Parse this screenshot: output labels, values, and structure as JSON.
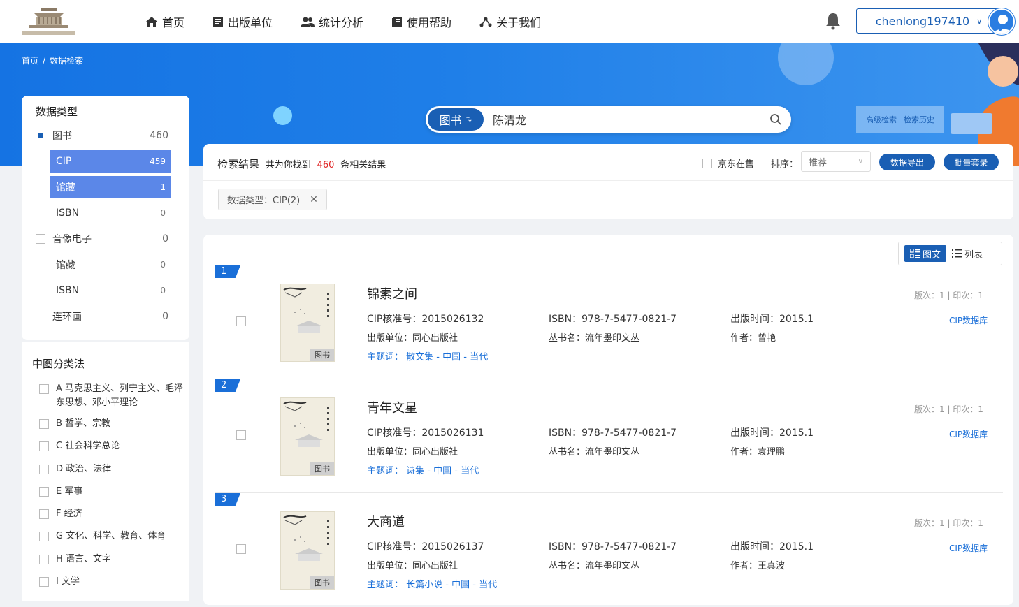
{
  "nav": {
    "home": "首页",
    "publishers": "出版单位",
    "statistics": "统计分析",
    "help": "使用帮助",
    "about": "关于我们"
  },
  "user": {
    "name": "chenlong197410"
  },
  "breadcrumb": {
    "home": "首页",
    "sep": "/",
    "current": "数据检索"
  },
  "search": {
    "type": "图书",
    "type_arrow": "⇅",
    "query": "陈清龙",
    "advanced": "高级检索",
    "history": "检索历史"
  },
  "sidebar": {
    "data_type_title": "数据类型",
    "types": [
      {
        "label": "图书",
        "count": "460",
        "checked": true,
        "subs": [
          {
            "label": "CIP",
            "count": "459",
            "active": true
          },
          {
            "label": "馆藏",
            "count": "1",
            "active": true
          },
          {
            "label": "ISBN",
            "count": "0",
            "active": false
          }
        ]
      },
      {
        "label": "音像电子",
        "count": "0",
        "checked": false,
        "subs": [
          {
            "label": "馆藏",
            "count": "0",
            "active": false
          },
          {
            "label": "ISBN",
            "count": "0",
            "active": false
          }
        ]
      },
      {
        "label": "连环画",
        "count": "0",
        "checked": false,
        "subs": []
      }
    ],
    "class_title": "中图分类法",
    "classes": [
      "A 马克思主义、列宁主义、毛泽东思想、邓小平理论",
      "B 哲学、宗教",
      "C 社会科学总论",
      "D 政治、法律",
      "E 军事",
      "F 经济",
      "G 文化、科学、教育、体育",
      "H 语言、文字",
      "I 文学"
    ]
  },
  "results": {
    "title": "检索结果",
    "found_prefix": "共为你找到",
    "count": "460",
    "found_suffix": "条相关结果",
    "jd_label": "京东在售",
    "sort_label": "排序：",
    "sort_value": "推荐",
    "export_label": "数据导出",
    "batch_label": "批量套录",
    "filter_tag": "数据类型：CIP(2)",
    "view_grid": "图文",
    "view_list": "列表"
  },
  "items": [
    {
      "index": "1",
      "title": "锦素之间",
      "cip": "CIP核准号：2015026132",
      "isbn": "ISBN：978-7-5477-0821-7",
      "pubdate": "出版时间：2015.1",
      "publisher": "出版单位：同心出版社",
      "series": "丛书名：流年墨印文丛",
      "author": "作者：曾艳",
      "subject_label": "主题词：",
      "subject": "散文集 - 中国 - 当代",
      "edition": "版次：1 | 印次：1",
      "db": "CIP数据库",
      "badge": "图书"
    },
    {
      "index": "2",
      "title": "青年文星",
      "cip": "CIP核准号：2015026131",
      "isbn": "ISBN：978-7-5477-0821-7",
      "pubdate": "出版时间：2015.1",
      "publisher": "出版单位：同心出版社",
      "series": "丛书名：流年墨印文丛",
      "author": "作者：袁理鹏",
      "subject_label": "主题词：",
      "subject": "诗集 - 中国 - 当代",
      "edition": "版次：1 | 印次：1",
      "db": "CIP数据库",
      "badge": "图书"
    },
    {
      "index": "3",
      "title": "大商道",
      "cip": "CIP核准号：2015026137",
      "isbn": "ISBN：978-7-5477-0821-7",
      "pubdate": "出版时间：2015.1",
      "publisher": "出版单位：同心出版社",
      "series": "丛书名：流年墨印文丛",
      "author": "作者：王真波",
      "subject_label": "主题词：",
      "subject": "长篇小说 - 中国 - 当代",
      "edition": "版次：1 | 印次：1",
      "db": "CIP数据库",
      "badge": "图书"
    }
  ],
  "colors": {
    "primary": "#1a5fb4",
    "accent_blue": "#1a6fd8",
    "banner": "#1f7fe8",
    "active_sub": "#5b87e8",
    "count_red": "#e02424"
  },
  "icons": [
    "home-icon",
    "building-icon",
    "users-icon",
    "book-icon",
    "share-icon",
    "bell-icon",
    "chevron-down-icon",
    "search-icon",
    "close-icon",
    "grid-icon",
    "list-icon"
  ]
}
